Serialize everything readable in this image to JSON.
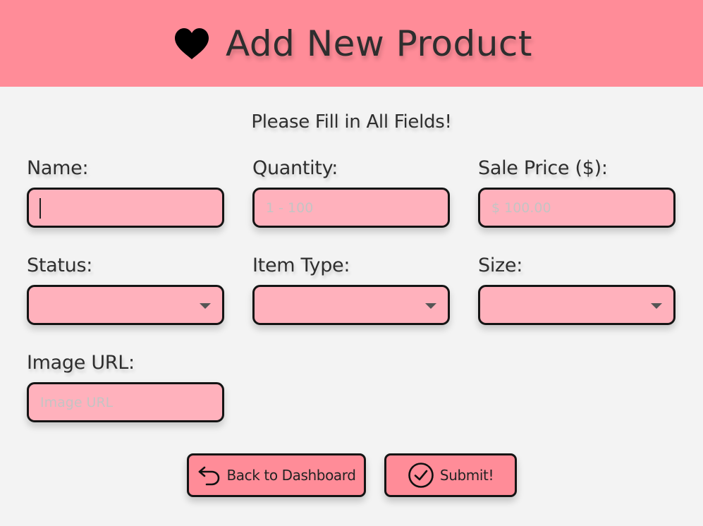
{
  "header": {
    "title": "Add New Product",
    "icon": "heart-icon",
    "background": "#ff8c98"
  },
  "form": {
    "instruction": "Please Fill in All Fields!",
    "fields": {
      "name": {
        "label": "Name:",
        "value": "",
        "placeholder": ""
      },
      "quantity": {
        "label": "Quantity:",
        "value": "",
        "placeholder": "1 - 100"
      },
      "sale_price": {
        "label": "Sale Price ($):",
        "value": "",
        "placeholder": "$ 100.00"
      },
      "status": {
        "label": "Status:",
        "selected": ""
      },
      "item_type": {
        "label": "Item Type:",
        "selected": ""
      },
      "size": {
        "label": "Size:",
        "selected": ""
      },
      "image_url": {
        "label": "Image URL:",
        "value": "",
        "placeholder": "Image URL"
      }
    },
    "field_background": "#ffb1bc"
  },
  "actions": {
    "back": {
      "label": "Back to Dashboard",
      "icon": "undo-arrow-icon"
    },
    "submit": {
      "label": "Submit!",
      "icon": "check-circle-icon"
    }
  }
}
